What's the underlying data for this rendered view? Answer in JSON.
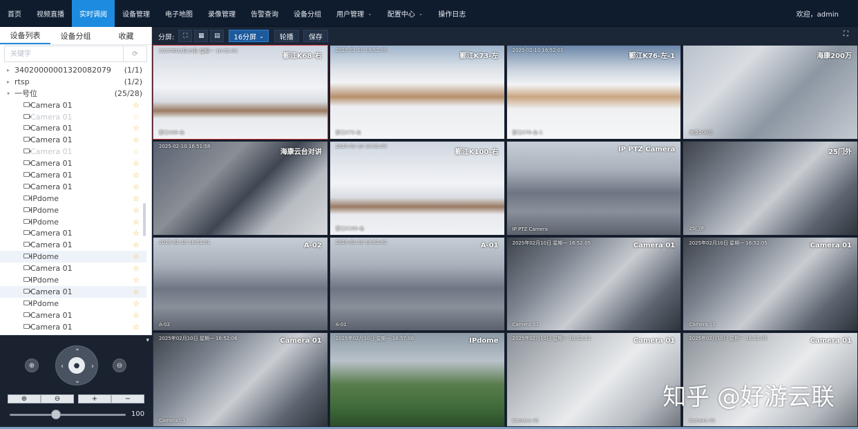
{
  "nav": {
    "items": [
      {
        "label": "首页",
        "active": false,
        "caret": false
      },
      {
        "label": "视频直播",
        "active": false,
        "caret": false
      },
      {
        "label": "实时调阅",
        "active": true,
        "caret": false
      },
      {
        "label": "设备管理",
        "active": false,
        "caret": false
      },
      {
        "label": "电子地图",
        "active": false,
        "caret": false
      },
      {
        "label": "录像管理",
        "active": false,
        "caret": false
      },
      {
        "label": "告警查询",
        "active": false,
        "caret": false
      },
      {
        "label": "设备分组",
        "active": false,
        "caret": false
      },
      {
        "label": "用户管理",
        "active": false,
        "caret": true
      },
      {
        "label": "配置中心",
        "active": false,
        "caret": true
      },
      {
        "label": "操作日志",
        "active": false,
        "caret": false
      }
    ],
    "user": "欢迎，admin"
  },
  "left": {
    "tabs": [
      "设备列表",
      "设备分组",
      "收藏"
    ],
    "active_tab": 0,
    "search_placeholder": "关键字",
    "tree": [
      {
        "type": "root",
        "label": "34020000001320082079",
        "count": "(1/1)",
        "expanded": false
      },
      {
        "type": "root",
        "label": "rtsp",
        "count": "(1/2)",
        "expanded": false
      },
      {
        "type": "root",
        "label": "一号位",
        "count": "(25/28)",
        "expanded": true
      },
      {
        "type": "cam",
        "label": "Camera 01",
        "offline": false,
        "highlight": false
      },
      {
        "type": "cam",
        "label": "Camera 01",
        "offline": true,
        "highlight": false
      },
      {
        "type": "cam",
        "label": "Camera 01",
        "offline": false,
        "highlight": false
      },
      {
        "type": "cam",
        "label": "Camera 01",
        "offline": false,
        "highlight": false
      },
      {
        "type": "cam",
        "label": "Camera 01",
        "offline": true,
        "highlight": false
      },
      {
        "type": "cam",
        "label": "Camera 01",
        "offline": false,
        "highlight": false
      },
      {
        "type": "cam",
        "label": "Camera 01",
        "offline": false,
        "highlight": false
      },
      {
        "type": "cam",
        "label": "Camera 01",
        "offline": false,
        "highlight": false
      },
      {
        "type": "cam",
        "label": "IPdome",
        "offline": false,
        "highlight": false
      },
      {
        "type": "cam",
        "label": "IPdome",
        "offline": false,
        "highlight": false
      },
      {
        "type": "cam",
        "label": "IPdome",
        "offline": false,
        "highlight": false
      },
      {
        "type": "cam",
        "label": "Camera 01",
        "offline": false,
        "highlight": false
      },
      {
        "type": "cam",
        "label": "Camera 01",
        "offline": false,
        "highlight": false
      },
      {
        "type": "cam",
        "label": "IPdome",
        "offline": false,
        "highlight": true
      },
      {
        "type": "cam",
        "label": "Camera 01",
        "offline": false,
        "highlight": false
      },
      {
        "type": "cam",
        "label": "IPdome",
        "offline": false,
        "highlight": false
      },
      {
        "type": "cam",
        "label": "Camera 01",
        "offline": false,
        "highlight": true
      },
      {
        "type": "cam",
        "label": "IPdome",
        "offline": false,
        "highlight": false
      },
      {
        "type": "cam",
        "label": "Camera 01",
        "offline": false,
        "highlight": false
      },
      {
        "type": "cam",
        "label": "Camera 01",
        "offline": false,
        "highlight": false
      }
    ]
  },
  "ptz": {
    "zoom_in_glyph": "⊕",
    "zoom_out_glyph": "⊖",
    "speed_value": 0.4,
    "speed_label": "100"
  },
  "toolbar": {
    "split_label": "分屏:",
    "split_select": "16分屏",
    "patrol_label": "轮播",
    "save_label": "保存"
  },
  "tiles": [
    {
      "title": "鄞江K68-右",
      "time": "2025年02月10日 星期一 16:52:03",
      "sub": "鄞江K68-右",
      "scene": "scene-snow",
      "selected": true
    },
    {
      "title": "鄞江K73-左",
      "time": "2025-02-10 16:52:00",
      "sub": "鄞江K73-左",
      "scene": "scene-snow2",
      "selected": false
    },
    {
      "title": "鄞江K76-左-1",
      "time": "2025-02-10 16:52:01",
      "sub": "鄞江K76-左-1",
      "scene": "scene-snow3",
      "selected": false
    },
    {
      "title": "海康200万",
      "time": "",
      "sub": "海康200万",
      "scene": "scene-build",
      "selected": false
    },
    {
      "title": "海康云台对讲",
      "time": "2025-02-10 16:51:58",
      "sub": "",
      "scene": "scene-park",
      "selected": false
    },
    {
      "title": "鄞江K100-右",
      "time": "2025-02-10 16:52:04",
      "sub": "鄞江K100-右",
      "scene": "scene-snow",
      "selected": false
    },
    {
      "title": "IP PTZ Camera",
      "time": "",
      "sub": "IP PTZ Camera",
      "scene": "scene-road",
      "selected": false
    },
    {
      "title": "25门外",
      "time": "",
      "sub": "25门外",
      "scene": "scene-ind",
      "selected": false
    },
    {
      "title": "A-02",
      "time": "2025-02-10 16:52:01",
      "sub": "A-02",
      "scene": "scene-road",
      "selected": false
    },
    {
      "title": "A-01",
      "time": "2025-02-10 16:52:02",
      "sub": "A-01",
      "scene": "scene-road",
      "selected": false
    },
    {
      "title": "Camera 01",
      "time": "2025年02月10日 星期一 16:52:05",
      "sub": "Camera 01",
      "scene": "scene-ind",
      "selected": false
    },
    {
      "title": "Camera 01",
      "time": "2025年02月10日 星期一 16:52:05",
      "sub": "Camera 01",
      "scene": "scene-ind",
      "selected": false
    },
    {
      "title": "Camera 01",
      "time": "2025年02月10日 星期一 16:52:06",
      "sub": "Camera 01",
      "scene": "scene-ind",
      "selected": false
    },
    {
      "title": "IPdome",
      "time": "2025年02月10日 星期一 16:57:06",
      "sub": "",
      "scene": "scene-green",
      "selected": false
    },
    {
      "title": "Camera 01",
      "time": "2025年02月10日 星期一 16:52:13",
      "sub": "Camera 01",
      "scene": "scene-fog",
      "selected": false
    },
    {
      "title": "Camera 01",
      "time": "2025年02月10日 星期一 16:52:06",
      "sub": "Camera 01",
      "scene": "scene-fog",
      "selected": false
    }
  ],
  "watermark": "知乎 @好游云联",
  "colors": {
    "nav_bg": "#0f1c2e",
    "accent": "#1d8ce0",
    "star": "#f2b01e",
    "selected_border": "#d93a3a"
  }
}
